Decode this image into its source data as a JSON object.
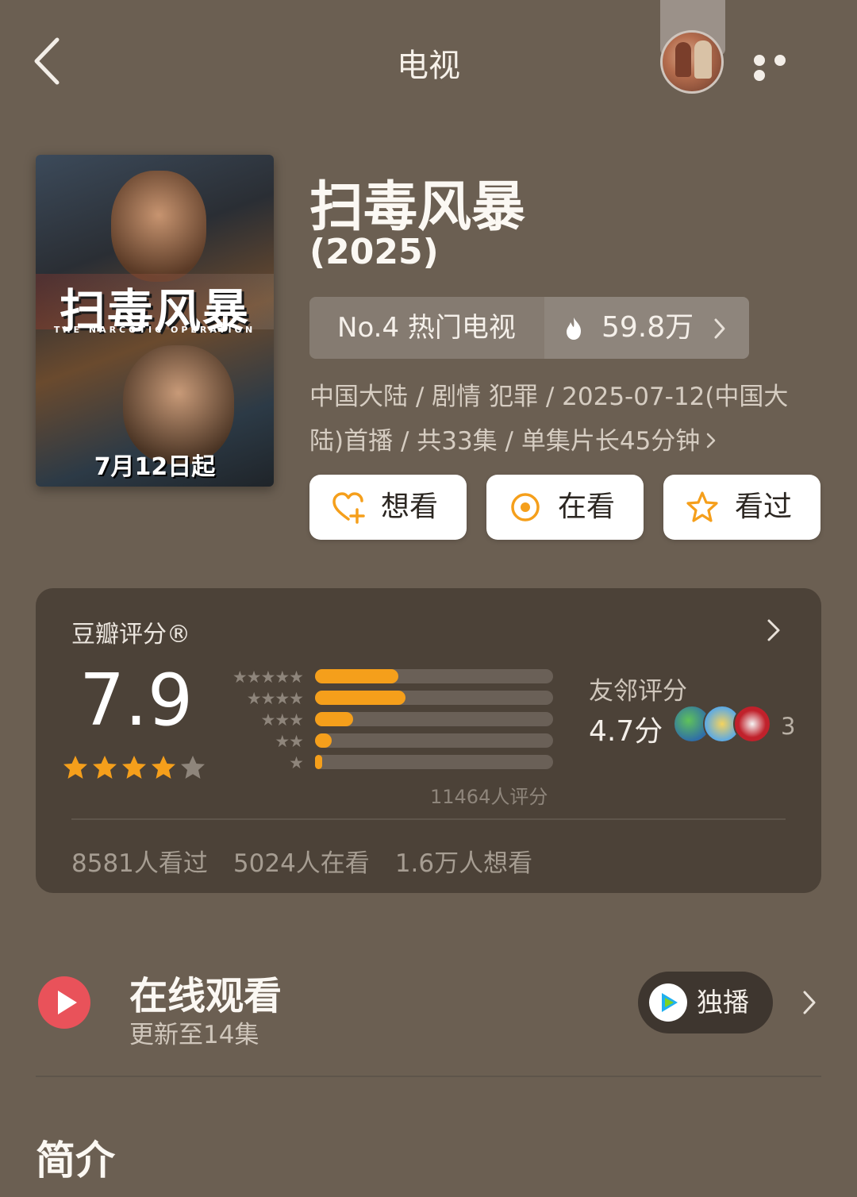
{
  "nav": {
    "title": "电视",
    "back_icon": "chevron-left-icon",
    "more_icon": "more-horizontal-icon"
  },
  "poster": {
    "title_text": "扫毒风暴",
    "english_title": "THE NARCOTIC OPERATION",
    "date_text": "7月12日起"
  },
  "show": {
    "title": "扫毒风暴",
    "year": "(2025)",
    "rank_label": "No.4 热门电视",
    "heat_value": "59.8万",
    "meta_line1": "中国大陆 / 剧情 犯罪 / 2025-07-12(中国大",
    "meta_line2": "陆)首播 / 共33集 / 单集片长45分钟"
  },
  "actions": {
    "want": "想看",
    "watching": "在看",
    "watched": "看过"
  },
  "rating": {
    "label": "豆瓣评分®",
    "score": "7.9",
    "stars": 4,
    "distribution": [
      {
        "stars": 5,
        "fraction": 0.35
      },
      {
        "stars": 4,
        "fraction": 0.38
      },
      {
        "stars": 3,
        "fraction": 0.16
      },
      {
        "stars": 2,
        "fraction": 0.07
      },
      {
        "stars": 1,
        "fraction": 0.03
      }
    ],
    "rating_count": "11464人评分",
    "friends_label": "友邻评分",
    "friends_score": "4.7分",
    "friends_count": "3",
    "stats": {
      "watched": "8581人看过",
      "watching": "5024人在看",
      "want": "1.6万人想看"
    }
  },
  "watch": {
    "title": "在线观看",
    "subtitle": "更新至14集",
    "exclusive_label": "独播"
  },
  "intro": {
    "title": "简介"
  },
  "colors": {
    "background": "#6b5f52",
    "card": "#4c4238",
    "accent_orange": "#f59f1b",
    "play_red": "#e9525a"
  }
}
